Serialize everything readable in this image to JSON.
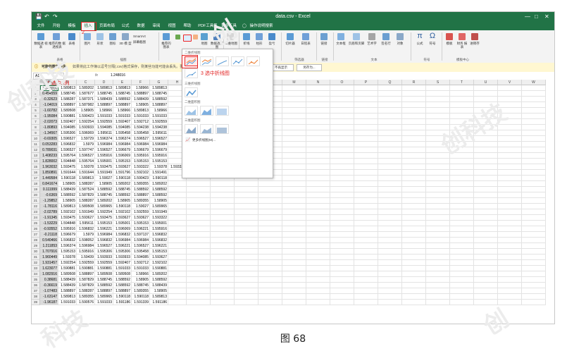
{
  "window": {
    "title": "data.csv  -  Excel"
  },
  "quick_access": {
    "save_icon": "save-icon",
    "undo_icon": "undo-icon",
    "redo_icon": "redo-icon"
  },
  "tabs": [
    "文件",
    "开始",
    "模板",
    "插入",
    "页面布局",
    "公式",
    "数据",
    "审阅",
    "视图",
    "帮助",
    "PDF工具集",
    "更多工具",
    "操作说明搜索"
  ],
  "active_tab": "插入",
  "ribbon": {
    "items": [
      {
        "label": "数据透\n视表",
        "icon": "pivot-table-icon"
      },
      {
        "label": "推荐的数\n据透视表",
        "icon": "recommended-pivot-icon"
      },
      {
        "label": "表格",
        "icon": "table-icon"
      },
      {
        "label": "图片",
        "icon": "picture-icon"
      },
      {
        "label": "形状",
        "icon": "shapes-icon"
      },
      {
        "label": "图标",
        "icon": "icons-icon"
      },
      {
        "label": "3D 模\n型",
        "icon": "3d-model-icon"
      },
      {
        "label": "SmartArt",
        "icon": "smartart-icon"
      },
      {
        "label": "屏幕截图",
        "icon": "screenshot-icon"
      },
      {
        "label": "推荐的\n图表",
        "icon": "recommended-charts-icon"
      },
      {
        "label": "地图",
        "icon": "map-icon"
      },
      {
        "label": "数据透视图",
        "icon": "pivot-chart-icon"
      },
      {
        "label": "三维地图",
        "icon": "3d-map-icon"
      },
      {
        "label": "折线",
        "icon": "sparkline-line-icon"
      },
      {
        "label": "柱形",
        "icon": "sparkline-column-icon"
      },
      {
        "label": "盈亏",
        "icon": "sparkline-winloss-icon"
      },
      {
        "label": "切片器",
        "icon": "slicer-icon"
      },
      {
        "label": "日程表",
        "icon": "timeline-icon"
      },
      {
        "label": "链接",
        "icon": "link-icon"
      },
      {
        "label": "文本框",
        "icon": "textbox-icon"
      },
      {
        "label": "页眉和页脚",
        "icon": "header-footer-icon"
      },
      {
        "label": "艺术字",
        "icon": "wordart-icon"
      },
      {
        "label": "签名行",
        "icon": "signature-icon"
      },
      {
        "label": "对象",
        "icon": "object-icon"
      },
      {
        "label": "公式",
        "icon": "equation-icon"
      },
      {
        "label": "符号",
        "icon": "symbol-icon"
      },
      {
        "label": "模板",
        "icon": "template-icon"
      },
      {
        "label": "财务\n报表",
        "icon": "finance-report-icon"
      },
      {
        "label": "进销存",
        "icon": "inventory-icon"
      }
    ],
    "groups": [
      "表格",
      "插图",
      "迷你图",
      "筛选器",
      "链接",
      "文本",
      "符号",
      "模板中心"
    ]
  },
  "infobar": {
    "label": "可能的数据丢失",
    "message": "如果将此工作簿以逗号分隔(.csv)格式保存，则某些功能可能会丢失。要保留这些功能，请以Excel文件格式保存。",
    "btn_dont_show": "不再显示",
    "btn_save_as": "另存为..."
  },
  "formula_bar": {
    "name_box": "A1",
    "fx": "fx",
    "value": "1.248016"
  },
  "columns": [
    "A",
    "B",
    "C",
    "D",
    "E",
    "F",
    "G",
    "H",
    "I",
    "J",
    "K",
    "L",
    "M",
    "N",
    "O",
    "P",
    "Q",
    "R",
    "S",
    "T",
    "U",
    "V",
    "W"
  ],
  "rows": [
    [
      "1.248016",
      "1.589813",
      "1.589202",
      "1.589813",
      "1.589813",
      "1.58966",
      "1.589813"
    ],
    [
      "0.454559",
      "1.588745",
      "1.587677",
      "1.588745",
      "1.588745",
      "1.588897",
      "1.588745"
    ],
    [
      "-0.32623",
      "1.588287",
      "1.587371",
      "1.588439",
      "1.588592",
      "1.588439",
      "1.588592"
    ],
    [
      "-1.04019",
      "1.588897",
      "1.587982",
      "1.588897",
      "1.588897",
      "1.58905",
      "1.588897"
    ],
    [
      "-1.60782",
      "1.589508",
      "1.58905",
      "1.58966",
      "1.58966",
      "1.589813",
      "1.58966"
    ],
    [
      "-1.95084",
      "1.590881",
      "1.590423",
      "1.591033",
      "1.591033",
      "1.591033",
      "1.591033"
    ],
    [
      "-2.02073",
      "1.592407",
      "1.592254",
      "1.592559",
      "1.592407",
      "1.592712",
      "1.592559"
    ],
    [
      "-1.80893",
      "1.594085",
      "1.593933",
      "1.594085",
      "1.594085",
      "1.594238",
      "1.594238"
    ],
    [
      "-1.34567",
      "1.595306",
      "1.596069",
      "1.595611",
      "1.595458",
      "1.595458",
      "1.595611"
    ],
    [
      "-0.69305",
      "1.596527",
      "1.59729",
      "1.596374",
      "1.596374",
      "1.596527",
      "1.596527"
    ],
    [
      "0.053283",
      "1.596832",
      "1.5979",
      "1.596984",
      "1.596984",
      "1.596984",
      "1.596984"
    ],
    [
      "0.789031",
      "1.596527",
      "1.597747",
      "1.596527",
      "1.596679",
      "1.596679",
      "1.596679"
    ],
    [
      "1.408233",
      "1.595764",
      "1.596527",
      "1.595916",
      "1.596069",
      "1.595916",
      "1.595916"
    ],
    [
      "1.828002",
      "1.594848",
      "1.595764",
      "1.595001",
      "1.595153",
      "1.595153",
      "1.595153"
    ],
    [
      "1.963032",
      "1.593475",
      "1.59378",
      "1.593475",
      "1.593627",
      "1.593322",
      "1.59378",
      "1.593322"
    ],
    [
      "1.850891",
      "1.591644",
      "1.591644",
      "1.591949",
      "1.591796",
      "1.592102",
      "1.591491"
    ],
    [
      "1.449584",
      "1.590118",
      "1.589813",
      "1.59027",
      "1.590118",
      "1.590423",
      "1.590118"
    ],
    [
      "0.841674",
      "1.58905",
      "1.588287",
      "1.58905",
      "1.589202",
      "1.589355",
      "1.589202"
    ],
    [
      "0.111999",
      "1.588439",
      "1.587524",
      "1.588592",
      "1.588745",
      "1.588592",
      "1.588592"
    ],
    [
      "-0.6369",
      "1.588592",
      "1.587829",
      "1.588745",
      "1.588592",
      "1.588897",
      "1.588592"
    ],
    [
      "-1.29852",
      "1.58905",
      "1.588287",
      "1.589202",
      "1.58905",
      "1.589355",
      "1.58905"
    ],
    [
      "-1.78116",
      "1.589813",
      "1.589508",
      "1.589965",
      "1.590118",
      "1.59027",
      "1.589965"
    ],
    [
      "-2.02789",
      "1.592102",
      "1.591949",
      "1.592254",
      "1.592102",
      "1.592559",
      "1.591949"
    ],
    [
      "-1.91345",
      "1.593475",
      "1.593627",
      "1.593475",
      "1.593627",
      "1.593627",
      "1.593322"
    ],
    [
      "-1.53229",
      "1.594848",
      "1.595611",
      "1.595153",
      "1.595001",
      "1.595153",
      "1.595001"
    ],
    [
      "-0.93552",
      "1.595916",
      "1.596832",
      "1.596221",
      "1.596069",
      "1.596221",
      "1.595916"
    ],
    [
      "-0.21118",
      "1.596679",
      "1.5979",
      "1.596984",
      "1.596832",
      "1.597137",
      "1.596832"
    ],
    [
      "0.540466",
      "1.596832",
      "1.598052",
      "1.596832",
      "1.596984",
      "1.596984",
      "1.596832"
    ],
    [
      "1.211853",
      "1.596374",
      "1.596984",
      "1.596527",
      "1.596221",
      "1.596527",
      "1.596221"
    ],
    [
      "1.707916",
      "1.595153",
      "1.595916",
      "1.595306",
      "1.595306",
      "1.595458",
      "1.595153"
    ],
    [
      "1.960449",
      "1.59378",
      "1.59439",
      "1.593933",
      "1.593933",
      "1.594085",
      "1.593627"
    ],
    [
      "1.931457",
      "1.592254",
      "1.592559",
      "1.592559",
      "1.592407",
      "1.592712",
      "1.592102"
    ],
    [
      "1.623077",
      "1.590881",
      "1.590881",
      "1.590881",
      "1.591033",
      "1.591033",
      "1.590881"
    ],
    [
      "1.082916",
      "1.589508",
      "1.588897",
      "1.589508",
      "1.589508",
      "1.58966",
      "1.589202"
    ],
    [
      "0.38681",
      "1.588439",
      "1.587829",
      "1.588745",
      "1.588592",
      "1.58905",
      "1.588592"
    ],
    [
      "-0.36619",
      "1.588439",
      "1.587829",
      "1.588592",
      "1.588592",
      "1.588745",
      "1.588439"
    ],
    [
      "-1.07483",
      "1.588897",
      "1.588287",
      "1.588897",
      "1.588897",
      "1.589355",
      "1.58905"
    ],
    [
      "-1.63147",
      "1.589813",
      "1.589355",
      "1.589965",
      "1.590118",
      "1.590118",
      "1.589813"
    ],
    [
      "-1.96187",
      "1.591033",
      "1.590576",
      "1.591033",
      "1.591186",
      "1.591339",
      "1.591186"
    ]
  ],
  "dropdown": {
    "section_2d_line": "二维折线图",
    "section_3d_line": "三维折线图",
    "section_2d_area": "二维面积图",
    "section_3d_area": "三维面积图",
    "more_charts": "更多折线图(M)..."
  },
  "annotations": {
    "step1": "1 选中A列",
    "step2": "2",
    "step3": "3 选中折线图"
  },
  "caption": "图  68",
  "watermark": [
    "创科技",
    "创",
    "创科技",
    "科技",
    "创"
  ],
  "colors": {
    "excel_green": "#217346",
    "annotation_red": "#e22222",
    "info_bar": "#fff7d1"
  }
}
